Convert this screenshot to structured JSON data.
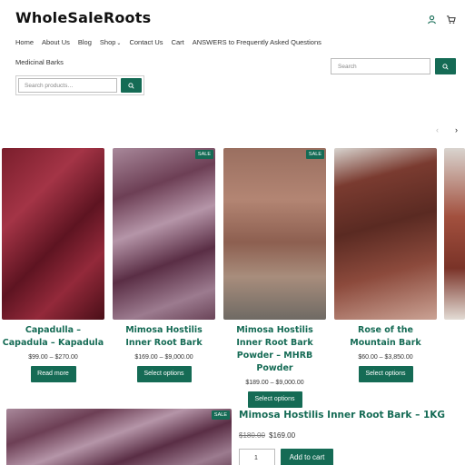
{
  "header": {
    "logo": "WholeSaleRoots",
    "icons": [
      "user-icon",
      "cart-icon"
    ]
  },
  "nav": {
    "items": [
      "Home",
      "About Us",
      "Blog",
      "Shop",
      "Contact Us",
      "Cart",
      "ANSWERS to Frequently Asked Questions"
    ],
    "second_row": "Medicinal Barks"
  },
  "search": {
    "products_placeholder": "Search products…",
    "site_placeholder": "Search"
  },
  "colors": {
    "accent": "#156b55"
  },
  "products": [
    {
      "title": "Capadulla – Capadula – Kapadula",
      "price": "$99.00 – $270.00",
      "button": "Read more",
      "sale": ""
    },
    {
      "title": "Mimosa Hostilis Inner Root Bark",
      "price": "$169.00 – $9,000.00",
      "button": "Select options",
      "sale": "SALE"
    },
    {
      "title": "Mimosa Hostilis Inner Root Bark Powder – MHRB Powder",
      "price": "$189.00 – $9,000.00",
      "button": "Select options",
      "sale": "SALE"
    },
    {
      "title": "Rose of the Mountain Bark",
      "price": "$60.00 – $3,850.00",
      "button": "Select options",
      "sale": ""
    }
  ],
  "featured": {
    "sale": "SALE",
    "title": "Mimosa Hostilis Inner Root Bark – 1KG",
    "old_price": "$180.00",
    "price": "$169.00",
    "quantity": "1",
    "add_to_cart": "Add to cart"
  }
}
